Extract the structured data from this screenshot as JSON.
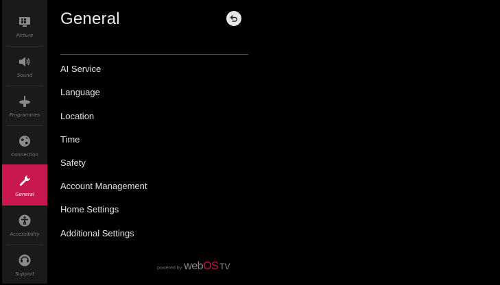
{
  "sidebar": {
    "items": [
      {
        "label": "Picture",
        "icon": "picture-icon"
      },
      {
        "label": "Sound",
        "icon": "speaker-icon"
      },
      {
        "label": "Programmes",
        "icon": "antenna-icon"
      },
      {
        "label": "Connection",
        "icon": "globe-icon"
      },
      {
        "label": "General",
        "icon": "wrench-icon",
        "active": true
      },
      {
        "label": "Accessibility",
        "icon": "accessibility-icon"
      },
      {
        "label": "Support",
        "icon": "support-icon"
      }
    ]
  },
  "panel": {
    "title": "General",
    "back_icon": "back-arrow-icon",
    "menu": [
      "AI Service",
      "Language",
      "Location",
      "Time",
      "Safety",
      "Account Management",
      "Home Settings",
      "Additional Settings"
    ],
    "footer": {
      "powered_by": "powered by",
      "brand_web": "web",
      "brand_os": "OS",
      "brand_tv": "TV"
    }
  },
  "colors": {
    "accent": "#c8174f",
    "background": "#000000",
    "sidebar": "#1a1a1a"
  }
}
